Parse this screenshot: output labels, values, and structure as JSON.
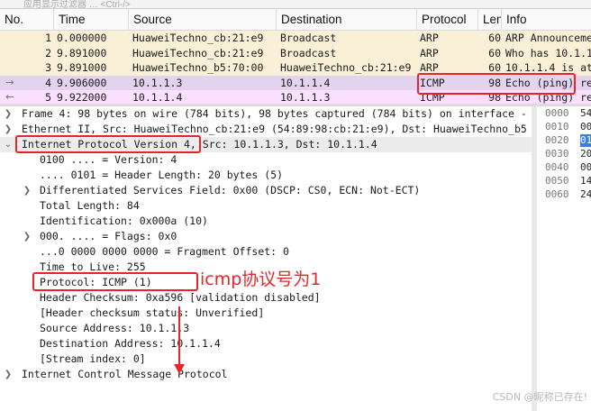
{
  "filter_placeholder": "应用显示过滤器 … <Ctrl-/>",
  "packet_list": {
    "columns": [
      "No.",
      "Time",
      "Source",
      "Destination",
      "Protocol",
      "Len",
      "Info"
    ],
    "rows": [
      {
        "no": "1",
        "time": "0.000000",
        "source": "HuaweiTechno_cb:21:e9",
        "destination": "Broadcast",
        "protocol": "ARP",
        "len": "60",
        "info": "ARP Announcement"
      },
      {
        "no": "2",
        "time": "9.891000",
        "source": "HuaweiTechno_cb:21:e9",
        "destination": "Broadcast",
        "protocol": "ARP",
        "len": "60",
        "info": "Who has 10.1.1"
      },
      {
        "no": "3",
        "time": "9.891000",
        "source": "HuaweiTechno_b5:70:00",
        "destination": "HuaweiTechno_cb:21:e9",
        "protocol": "ARP",
        "len": "60",
        "info": "10.1.1.4 is at"
      },
      {
        "no": "4",
        "time": "9.906000",
        "source": "10.1.1.3",
        "destination": "10.1.1.4",
        "protocol": "ICMP",
        "len": "98",
        "info": "Echo (ping) re"
      },
      {
        "no": "5",
        "time": "9.922000",
        "source": "10.1.1.4",
        "destination": "10.1.1.3",
        "protocol": "ICMP",
        "len": "98",
        "info": "Echo (ping) re"
      }
    ]
  },
  "details": [
    "Frame 4: 98 bytes on wire (784 bits), 98 bytes captured (784 bits) on interface -",
    "Ethernet II, Src: HuaweiTechno_cb:21:e9 (54:89:98:cb:21:e9), Dst: HuaweiTechno_b5",
    "Internet Protocol Version 4, Src: 10.1.1.3, Dst: 10.1.1.4",
    "0100 .... = Version: 4",
    ".... 0101 = Header Length: 20 bytes (5)",
    "Differentiated Services Field: 0x00 (DSCP: CS0, ECN: Not-ECT)",
    "Total Length: 84",
    "Identification: 0x000a (10)",
    "000. .... = Flags: 0x0",
    "...0 0000 0000 0000 = Fragment Offset: 0",
    "Time to Live: 255",
    "Protocol: ICMP (1)",
    "Header Checksum: 0xa596 [validation disabled]",
    "[Header checksum status: Unverified]",
    "Source Address: 10.1.1.3",
    "Destination Address: 10.1.1.4",
    "[Stream index: 0]",
    "Internet Control Message Protocol"
  ],
  "hex_pane": [
    {
      "offset": "0000",
      "bytes": "54"
    },
    {
      "offset": "0010",
      "bytes": "00"
    },
    {
      "offset": "0020",
      "bytes": "01"
    },
    {
      "offset": "0030",
      "bytes": "20"
    },
    {
      "offset": "0040",
      "bytes": "00"
    },
    {
      "offset": "0050",
      "bytes": "14"
    },
    {
      "offset": "0060",
      "bytes": "24"
    }
  ],
  "annotation": "icmp协议号为1",
  "watermark": "CSDN @昵称已存在!",
  "colors": {
    "annotation_red": "#e8242b",
    "arp_row": "#faf0d7",
    "icmp_row": "#fce0ff",
    "selected_row": "#e3d3ee",
    "hex_highlight": "#3c7fd6"
  }
}
